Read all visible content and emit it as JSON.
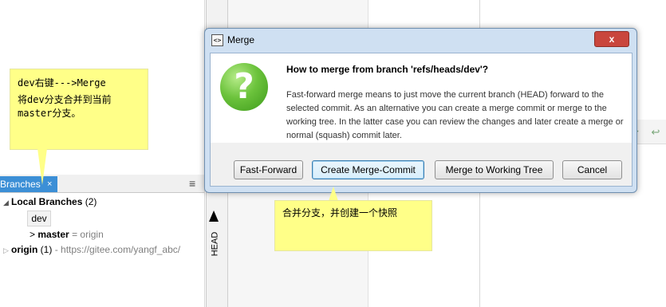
{
  "dialog": {
    "title_icon": "<>",
    "title": "Merge",
    "close_label": "x",
    "heading": "How to merge from branch 'refs/heads/dev'?",
    "body": "Fast-forward merge means to just move the current branch (HEAD) forward to the selected commit. As an alternative you can create a merge commit or merge to the working tree. In the latter case you can review the changes and later create a merge or normal (squash) commit later.",
    "buttons": {
      "fast_forward": "Fast-Forward",
      "create_merge_commit": "Create Merge-Commit",
      "merge_to_working_tree": "Merge to Working Tree",
      "cancel": "Cancel"
    },
    "icon": "question-icon"
  },
  "branches_view": {
    "tab_label": "Branches",
    "tab_close": "×",
    "menu_icon": "≡",
    "tree": {
      "local_label": "Local Branches",
      "local_count": "(2)",
      "dev": "dev",
      "master_prefix": ">",
      "master": "master",
      "master_tracking": "= origin",
      "origin_label": "origin",
      "origin_count": "(1)",
      "origin_url": "- https://gitee.com/yangf_abc/"
    }
  },
  "head_label": "HEAD",
  "notes": {
    "left_line1": "dev右键--->Merge",
    "left_line2": "将dev分支合并到当前master分支。",
    "bottom": "合并分支，并创建一个快照"
  },
  "colors": {
    "note_yellow": "#ffff88",
    "tab_blue": "#3c8fd6",
    "close_red": "#c9463d"
  }
}
